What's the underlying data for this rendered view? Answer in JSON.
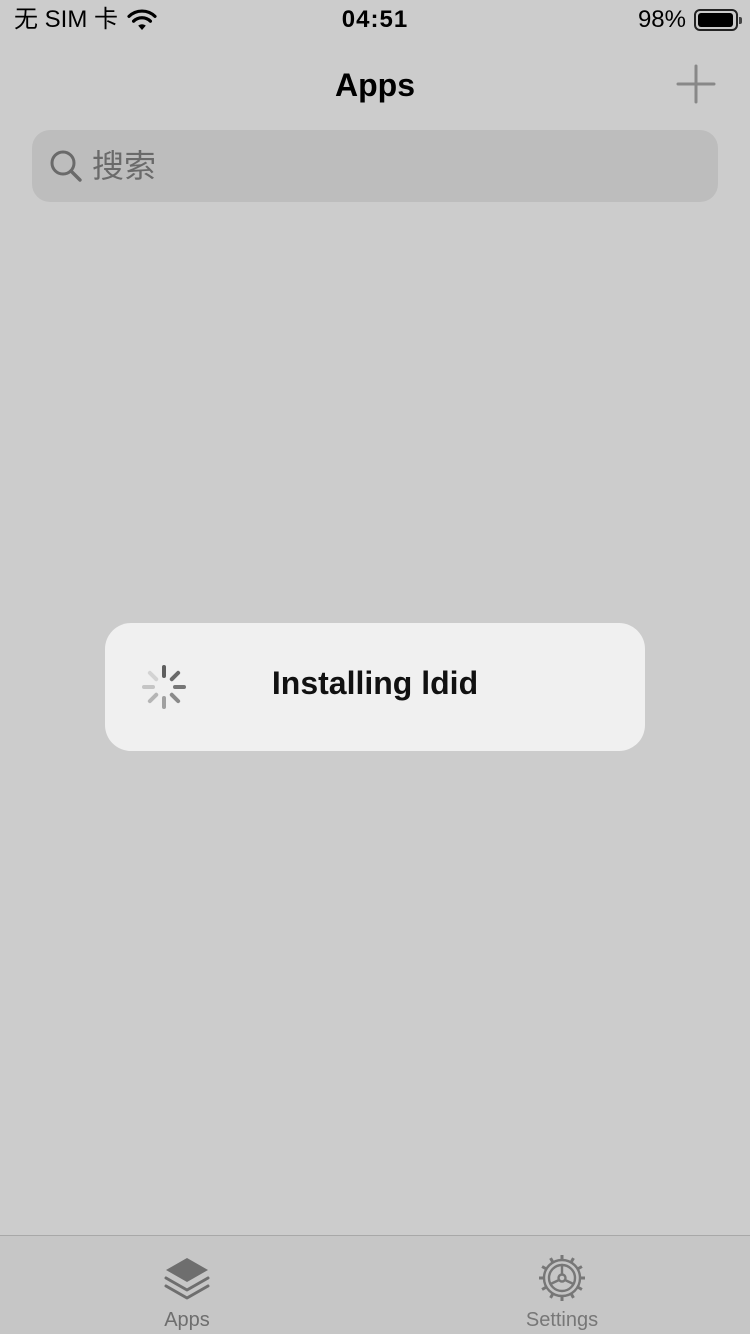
{
  "status_bar": {
    "carrier": "无 SIM 卡",
    "time": "04:51",
    "battery_percent": "98%",
    "battery_level": 0.98,
    "icons": [
      "wifi-icon",
      "battery-icon"
    ]
  },
  "nav": {
    "title": "Apps",
    "add_icon": "plus-icon"
  },
  "search": {
    "placeholder": "搜索",
    "value": "",
    "icon": "search-icon"
  },
  "hud": {
    "message": "Installing ldid",
    "icon": "spinner-icon"
  },
  "tab_bar": {
    "items": [
      {
        "label": "Apps",
        "icon": "layers-icon",
        "selected": true
      },
      {
        "label": "Settings",
        "icon": "gear-icon",
        "selected": false
      }
    ]
  },
  "colors": {
    "background": "#cccccc",
    "search_bg": "#bdbdbd",
    "hud_bg": "#f0f0f0",
    "tab_bar_bg": "#c6c6c6",
    "icon_gray": "#777777"
  }
}
